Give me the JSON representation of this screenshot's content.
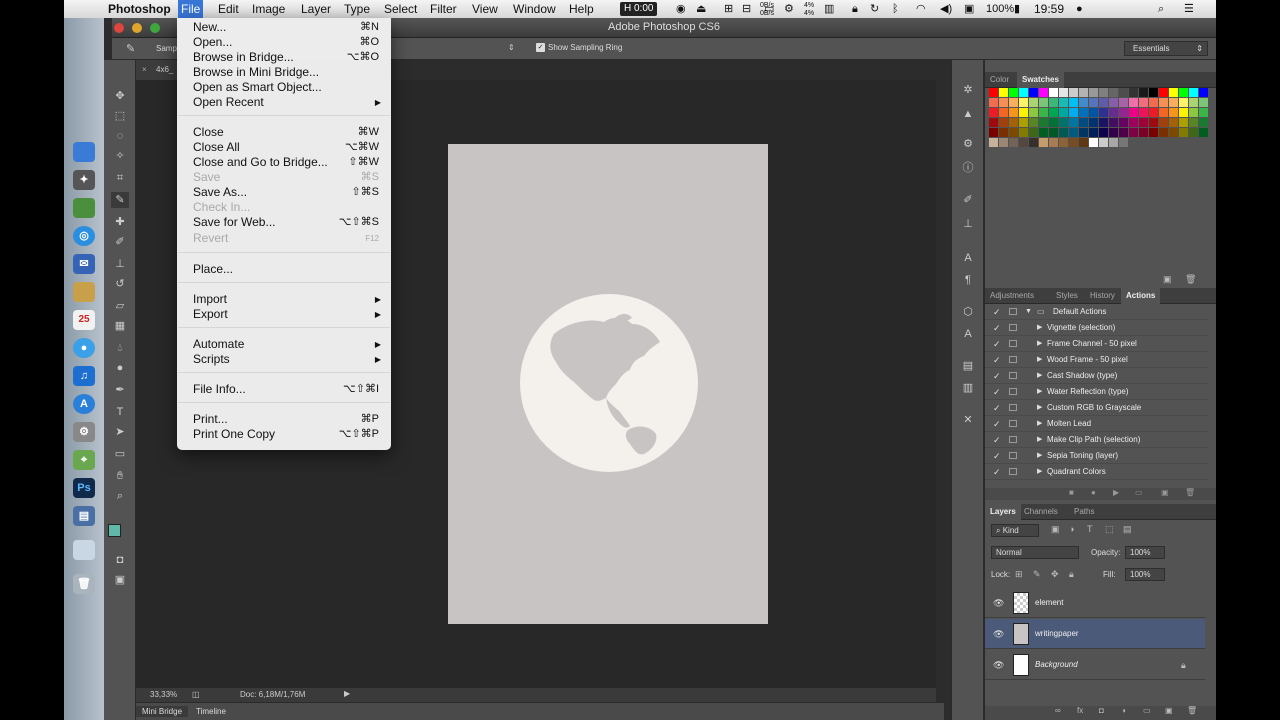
{
  "menubar": {
    "app_name": "Photoshop",
    "menus": [
      "File",
      "Edit",
      "Image",
      "Layer",
      "Type",
      "Select",
      "Filter",
      "View",
      "Window",
      "Help"
    ],
    "recording_time": "0:00",
    "net_up": "0B/s",
    "net_down": "0B/s",
    "cpu_1": "4%",
    "cpu_2": "4%",
    "battery": "100%",
    "clock": "19:59"
  },
  "app": {
    "title": "Adobe Photoshop CS6"
  },
  "options_bar": {
    "sample_label": "Samp",
    "show_sampling_ring": "Show Sampling Ring",
    "workspace": "Essentials"
  },
  "document": {
    "tab_label": "4x6_",
    "zoom": "33,33%",
    "doc_info": "Doc: 6,18M/1,76M"
  },
  "bottom_tabs": [
    "Mini Bridge",
    "Timeline"
  ],
  "file_menu": {
    "items": [
      {
        "label": "New...",
        "shortcut": "⌘N"
      },
      {
        "label": "Open...",
        "shortcut": "⌘O"
      },
      {
        "label": "Browse in Bridge...",
        "shortcut": "⌥⌘O"
      },
      {
        "label": "Browse in Mini Bridge...",
        "shortcut": ""
      },
      {
        "label": "Open as Smart Object...",
        "shortcut": ""
      },
      {
        "label": "Open Recent",
        "shortcut": "▶"
      },
      {
        "label": "Close",
        "shortcut": "⌘W"
      },
      {
        "label": "Close All",
        "shortcut": "⌥⌘W"
      },
      {
        "label": "Close and Go to Bridge...",
        "shortcut": "⇧⌘W"
      },
      {
        "label": "Save",
        "shortcut": "⌘S"
      },
      {
        "label": "Save As...",
        "shortcut": "⇧⌘S"
      },
      {
        "label": "Check In...",
        "shortcut": ""
      },
      {
        "label": "Save for Web...",
        "shortcut": "⌥⇧⌘S"
      },
      {
        "label": "Revert",
        "shortcut": "F12"
      },
      {
        "label": "Place...",
        "shortcut": ""
      },
      {
        "label": "Import",
        "shortcut": "▶"
      },
      {
        "label": "Export",
        "shortcut": "▶"
      },
      {
        "label": "Automate",
        "shortcut": "▶"
      },
      {
        "label": "Scripts",
        "shortcut": "▶"
      },
      {
        "label": "File Info...",
        "shortcut": "⌥⇧⌘I"
      },
      {
        "label": "Print...",
        "shortcut": "⌘P"
      },
      {
        "label": "Print One Copy",
        "shortcut": "⌥⇧⌘P"
      }
    ]
  },
  "color_panel": {
    "tabs": [
      "Color",
      "Swatches"
    ]
  },
  "actions_panel": {
    "tabs": [
      "Adjustments",
      "Styles",
      "History",
      "Actions"
    ],
    "set_name": "Default Actions",
    "actions": [
      "Vignette (selection)",
      "Frame Channel - 50 pixel",
      "Wood Frame - 50 pixel",
      "Cast Shadow (type)",
      "Water Reflection (type)",
      "Custom RGB to Grayscale",
      "Molten Lead",
      "Make Clip Path (selection)",
      "Sepia Toning (layer)",
      "Quadrant Colors"
    ]
  },
  "layers_panel": {
    "tabs": [
      "Layers",
      "Channels",
      "Paths"
    ],
    "filter_kind": "Kind",
    "blend_mode": "Normal",
    "opacity_label": "Opacity:",
    "opacity": "100%",
    "lock_label": "Lock:",
    "fill_label": "Fill:",
    "fill": "100%",
    "layers": [
      {
        "name": "element",
        "selected": false
      },
      {
        "name": "writingpaper",
        "selected": true
      },
      {
        "name": "Background",
        "selected": false
      }
    ]
  },
  "colors": {
    "menu_highlight": "#3876d8",
    "canvas_bg": "#c8c4c4",
    "globe": "#f4f0ec",
    "selected_layer": "#4a5a78"
  }
}
